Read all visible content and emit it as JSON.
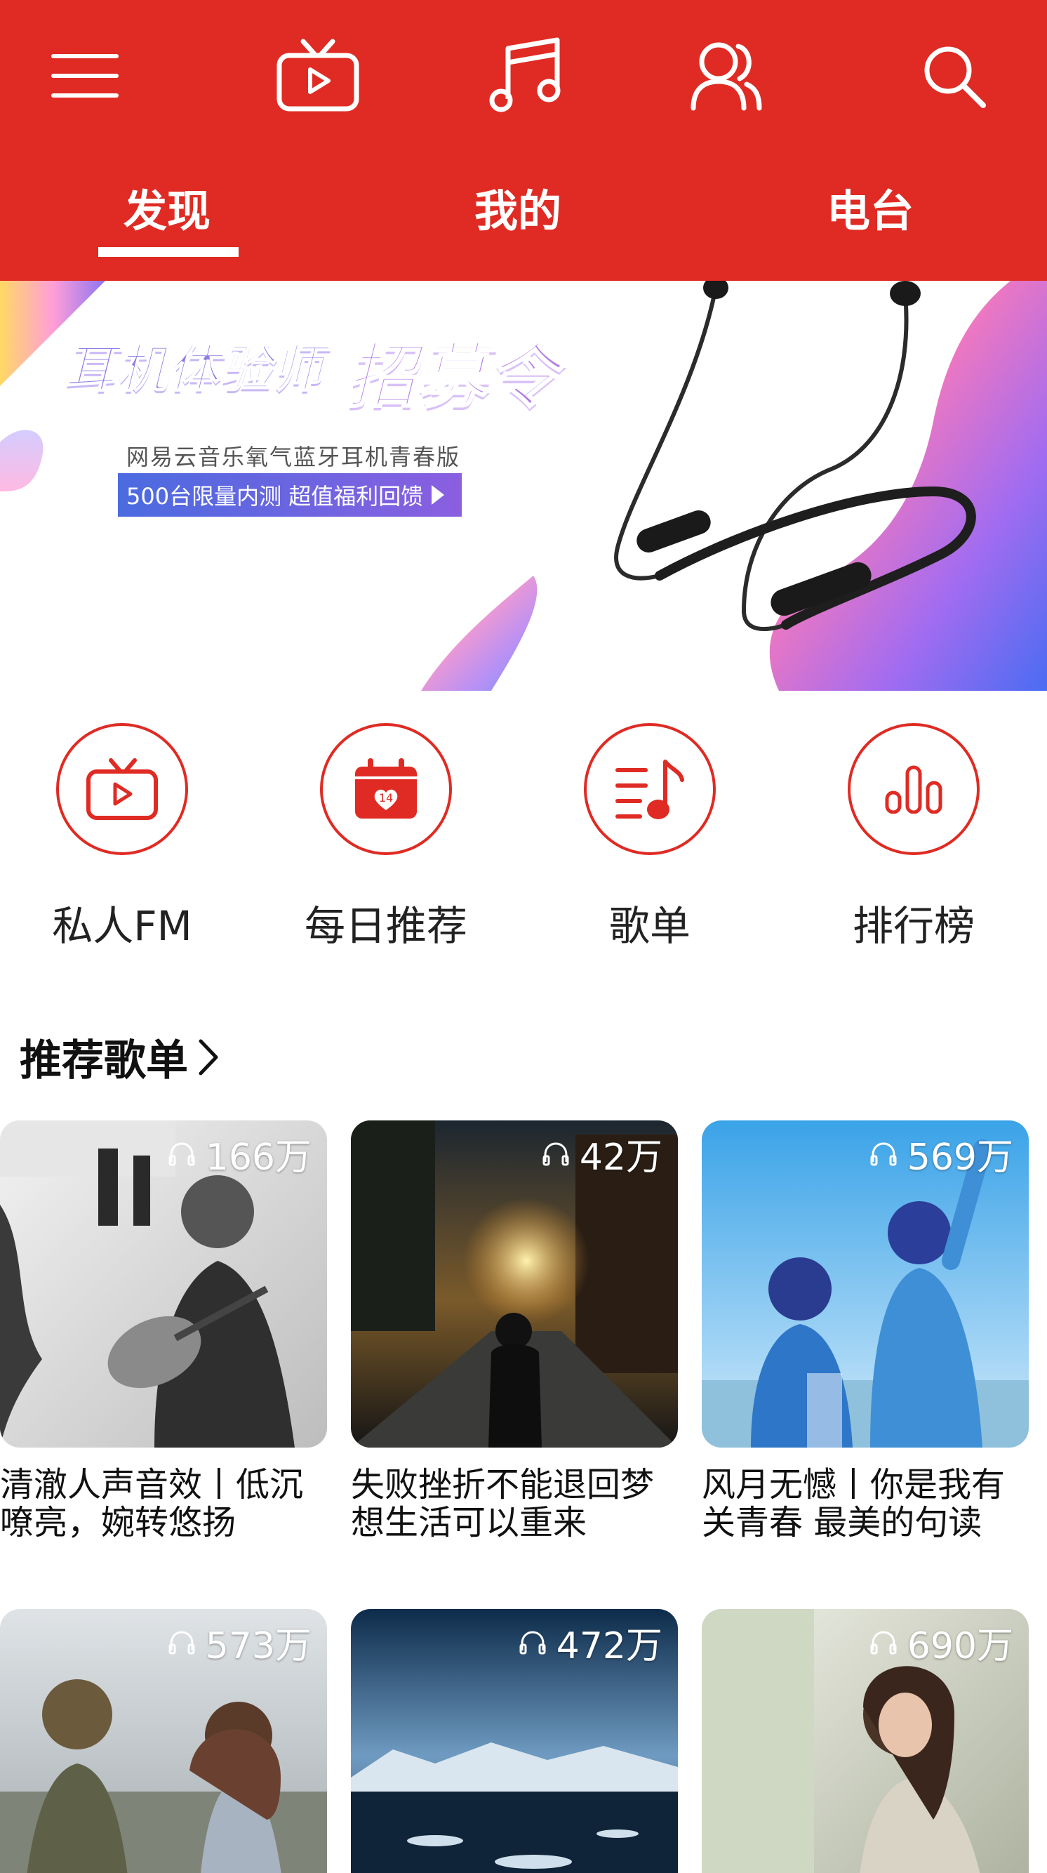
{
  "header": {
    "icons": [
      "menu-icon",
      "video-icon",
      "music-note-icon",
      "friends-icon",
      "search-icon"
    ],
    "tabs": [
      "发现",
      "我的",
      "电台"
    ],
    "active_tab": "发现"
  },
  "banner": {
    "title_part1": "耳机体验师",
    "title_part2": "招募令",
    "subtitle": "网易云音乐氧气蓝牙耳机青春版",
    "tag": "500台限量内测 超值福利回馈"
  },
  "quick_nav": [
    {
      "label": "私人FM",
      "icon": "radio-tv-icon"
    },
    {
      "label": "每日推荐",
      "icon": "calendar-icon",
      "badge": "14"
    },
    {
      "label": "歌单",
      "icon": "playlist-icon"
    },
    {
      "label": "排行榜",
      "icon": "chart-icon"
    }
  ],
  "section": {
    "title": "推荐歌单"
  },
  "playlists": [
    {
      "plays": "166万",
      "name": "清澈人声音效丨低沉嘹亮，婉转悠扬"
    },
    {
      "plays": "42万",
      "name": "失败挫折不能退回梦想生活可以重来"
    },
    {
      "plays": "569万",
      "name": "风月无憾丨你是我有关青春 最美的句读"
    },
    {
      "plays": "573万",
      "name": ""
    },
    {
      "plays": "472万",
      "name": ""
    },
    {
      "plays": "690万",
      "name": ""
    }
  ],
  "colors": {
    "brand_red": "#df2b23",
    "white": "#ffffff"
  }
}
